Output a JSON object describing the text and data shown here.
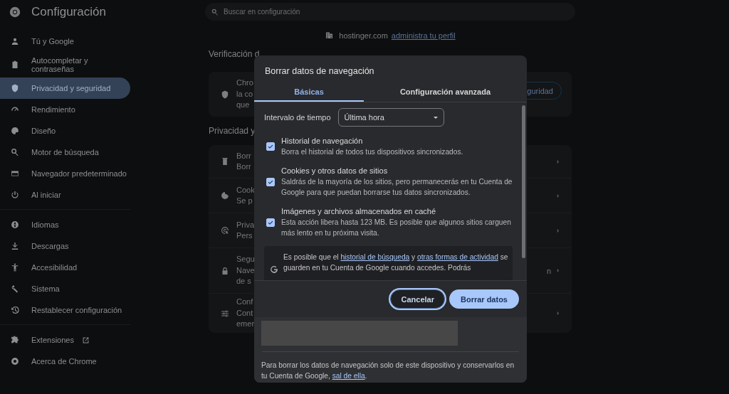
{
  "header": {
    "title": "Configuración"
  },
  "search": {
    "placeholder": "Buscar en configuración"
  },
  "sidebar": {
    "groups": [
      {
        "items": [
          {
            "label": "Tú y Google",
            "selected": false
          },
          {
            "label": "Autocompletar y contraseñas",
            "selected": false
          },
          {
            "label": "Privacidad y seguridad",
            "selected": true
          },
          {
            "label": "Rendimiento",
            "selected": false
          },
          {
            "label": "Diseño",
            "selected": false
          },
          {
            "label": "Motor de búsqueda",
            "selected": false
          },
          {
            "label": "Navegador predeterminado",
            "selected": false
          },
          {
            "label": "Al iniciar",
            "selected": false
          }
        ]
      },
      {
        "items": [
          {
            "label": "Idiomas",
            "selected": false
          },
          {
            "label": "Descargas",
            "selected": false
          },
          {
            "label": "Accesibilidad",
            "selected": false
          },
          {
            "label": "Sistema",
            "selected": false
          },
          {
            "label": "Restablecer configuración",
            "selected": false
          }
        ]
      },
      {
        "items": [
          {
            "label": "Extensiones",
            "selected": false,
            "external": true
          },
          {
            "label": "Acerca de Chrome",
            "selected": false
          }
        ]
      }
    ]
  },
  "managed": {
    "domain": "hostinger.com",
    "link": "administra tu perfil"
  },
  "safety_check": {
    "heading": "Verificación d",
    "lines": [
      "Chro",
      "la co",
      "que"
    ],
    "button": "guridad"
  },
  "privacy": {
    "heading": "Privacidad y",
    "rows": [
      {
        "lines": [
          "Borr",
          "Borr"
        ]
      },
      {
        "lines": [
          "Cook",
          "Se p"
        ]
      },
      {
        "lines": [
          "Priva",
          "Pers"
        ]
      },
      {
        "lines": [
          "Segu",
          "Nave",
          "de s"
        ],
        "trailing": "n"
      },
      {
        "lines": [
          "Conf",
          "Cont",
          "emer"
        ]
      }
    ]
  },
  "dialog": {
    "title": "Borrar datos de navegación",
    "tabs": [
      {
        "label": "Básicas",
        "selected": true
      },
      {
        "label": "Configuración avanzada",
        "selected": false
      }
    ],
    "time_range": {
      "label": "Intervalo de tiempo",
      "value": "Última hora"
    },
    "options": [
      {
        "title": "Historial de navegación",
        "description": "Borra el historial de todos tus dispositivos sincronizados.",
        "checked": true
      },
      {
        "title": "Cookies y otros datos de sitios",
        "description": "Saldrás de la mayoría de los sitios, pero permanecerás en tu Cuenta de Google para que puedan borrarse tus datos sincronizados.",
        "checked": true
      },
      {
        "title": "Imágenes y archivos almacenados en caché",
        "description": "Esta acción libera hasta 123 MB. Es posible que algunos sitios carguen más lento en tu próxima visita.",
        "checked": true
      }
    ],
    "notice": [
      {
        "text": "Es posible que el "
      },
      {
        "link": "historial de búsqueda"
      },
      {
        "text": " y "
      },
      {
        "link": "otras formas de actividad"
      },
      {
        "text": " se guarden en tu Cuenta de Google cuando accedes. Podrás"
      }
    ],
    "buttons": [
      {
        "label": "Cancelar",
        "kind": "outline"
      },
      {
        "label": "Borrar datos",
        "kind": "filled"
      }
    ],
    "footer": [
      {
        "text": "Para borrar los datos de navegación solo de este dispositivo y conservarlos en tu Cuenta de Google, "
      },
      {
        "link": "sal de ella"
      },
      {
        "text": "."
      }
    ]
  }
}
